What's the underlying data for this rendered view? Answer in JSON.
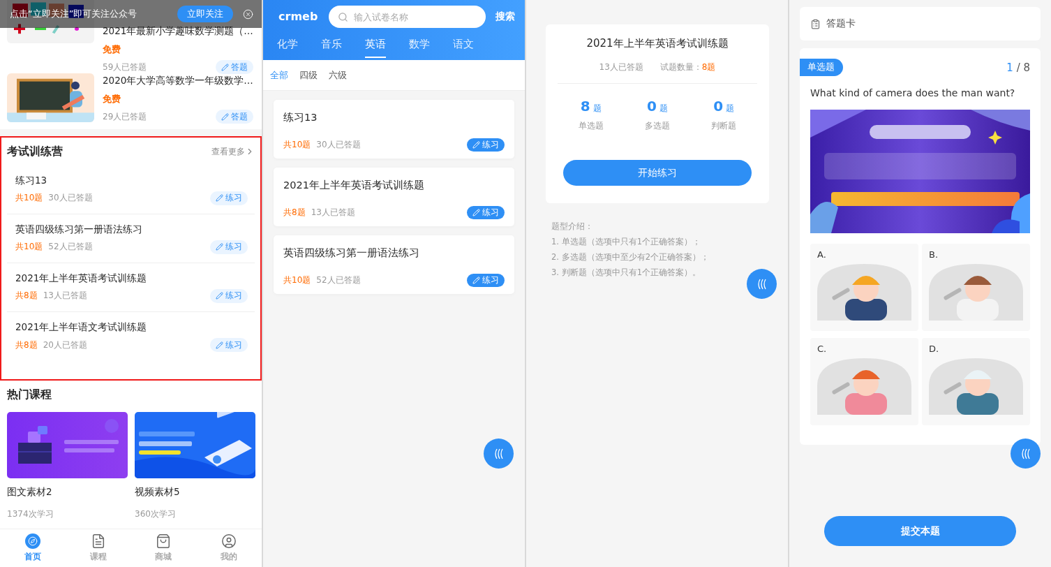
{
  "home": {
    "follow_bar": {
      "text": "点击“立即关注”即可关注公众号",
      "button": "立即关注"
    },
    "courses_top": [
      {
        "kind": "picture",
        "title": "2021年最新小学趣味数学测题（…",
        "price": "免费",
        "count": "59人已答题",
        "action": "答题"
      },
      {
        "kind": "picture",
        "title": "2020年大学高等数学一年级数学…",
        "price": "免费",
        "count": "29人已答题",
        "action": "答题"
      }
    ],
    "exam_camp": {
      "title": "考试训练营",
      "more": "查看更多",
      "highlighted": true,
      "items": [
        {
          "title": "练习13",
          "total": "共10题",
          "count": "30人已答题",
          "action": "练习"
        },
        {
          "title": "英语四级练习第一册语法练习",
          "total": "共10题",
          "count": "52人已答题",
          "action": "练习"
        },
        {
          "title": "2021年上半年英语考试训练题",
          "total": "共8题",
          "count": "13人已答题",
          "action": "练习"
        },
        {
          "title": "2021年上半年语文考试训练题",
          "total": "共8题",
          "count": "20人已答题",
          "action": "练习"
        }
      ]
    },
    "hot": {
      "title": "热门课程",
      "items": [
        {
          "kind": "picture",
          "title": "图文素材2",
          "count": "1374次学习"
        },
        {
          "kind": "picture",
          "title": "视频素材5",
          "count": "360次学习"
        }
      ]
    },
    "tabbar": [
      {
        "kind": "home",
        "label": "首页",
        "selected": true
      },
      {
        "kind": "course",
        "label": "课程",
        "selected": false
      },
      {
        "kind": "shop",
        "label": "商城",
        "selected": false
      },
      {
        "kind": "me",
        "label": "我的",
        "selected": false
      }
    ]
  },
  "exam_list": {
    "logo": "crmeb",
    "search": {
      "placeholder": "输入试卷名称",
      "button": "搜索"
    },
    "subjects": [
      {
        "label": "化学",
        "selected": false
      },
      {
        "label": "音乐",
        "selected": false
      },
      {
        "label": "英语",
        "selected": true
      },
      {
        "label": "数学",
        "selected": false
      },
      {
        "label": "语文",
        "selected": false
      }
    ],
    "levels": [
      {
        "label": "全部",
        "selected": true
      },
      {
        "label": "四级",
        "selected": false
      },
      {
        "label": "六级",
        "selected": false
      }
    ],
    "papers": [
      {
        "title": "练习13",
        "total": "共10题",
        "count": "30人已答题",
        "action": "练习"
      },
      {
        "title": "2021年上半年英语考试训练题",
        "total": "共8题",
        "count": "13人已答题",
        "action": "练习"
      },
      {
        "title": "英语四级练习第一册语法练习",
        "total": "共10题",
        "count": "52人已答题",
        "action": "练习"
      }
    ]
  },
  "exam_detail": {
    "title": "2021年上半年英语考试训练题",
    "answered": "13人已答题",
    "count_label": "试题数量：",
    "count": "8题",
    "types": [
      {
        "count": "8",
        "unit": "题",
        "label": "单选题"
      },
      {
        "count": "0",
        "unit": "题",
        "label": "多选题"
      },
      {
        "count": "0",
        "unit": "题",
        "label": "判断题"
      }
    ],
    "start": "开始练习",
    "intro": [
      "题型介绍：",
      "1. 单选题（选项中只有1个正确答案）；",
      "2. 多选题（选项中至少有2个正确答案）；",
      "3. 判断题（选项中只有1个正确答案）。"
    ]
  },
  "question": {
    "card_title": "答题卡",
    "type": "单选题",
    "index": "1",
    "rest": " / 8",
    "text": "What kind of camera does the man want?",
    "options": [
      {
        "label": "A.",
        "kind": "picture"
      },
      {
        "label": "B.",
        "kind": "picture"
      },
      {
        "label": "C.",
        "kind": "picture"
      },
      {
        "label": "D.",
        "kind": "picture"
      }
    ],
    "submit": "提交本题"
  }
}
